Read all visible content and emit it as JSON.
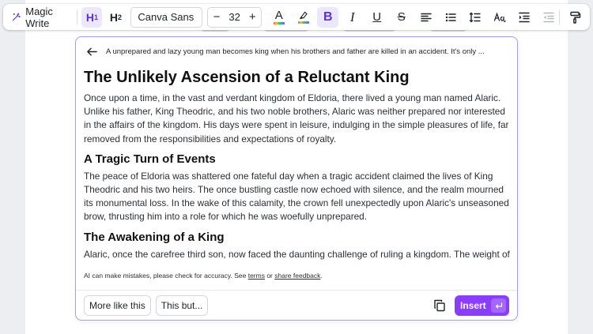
{
  "toolbar": {
    "magic_write_label": "Magic Write",
    "h1_label": "H",
    "h1_sub": "1",
    "h2_label": "H",
    "h2_sub": "2",
    "font_family": "Canva Sans",
    "font_size": "32",
    "decrement": "−",
    "increment": "+",
    "text_color_glyph": "A",
    "bold_glyph": "B",
    "italic_glyph": "I",
    "underline_glyph": "U",
    "strike_glyph": "S",
    "accent_color": "#5a32d6",
    "icons": [
      "magic-write-icon",
      "text-color-icon",
      "highlight-icon",
      "bold-icon",
      "italic-icon",
      "underline-icon",
      "strikethrough-icon",
      "align-left-icon",
      "bullet-list-icon",
      "line-spacing-icon",
      "text-case-icon",
      "indent-icon",
      "outdent-icon",
      "paint-roller-icon"
    ]
  },
  "card": {
    "prompt": "A unprepared and lazy young man becomes king when his brothers and father are killed in an accident. It's only ...",
    "title": "The Unlikely Ascension of a Reluctant King",
    "sections": [
      {
        "paragraph": "Once upon a time, in the vast and verdant kingdom of Eldoria, there lived a young man named Alaric. Unlike his father, King Theodric, and his two noble brothers, Alaric was neither prepared nor interested in the affairs of the kingdom. His days were spent in leisure, indulging in the simple pleasures of life, far removed from the responsibilities and expectations of royalty."
      },
      {
        "heading": "A Tragic Turn of Events",
        "paragraph": "The peace of Eldoria was shattered one fateful day when a tragic accident claimed the lives of King Theodric and his two heirs. The once bustling castle now echoed with silence, and the realm mourned its monumental loss. In the wake of this calamity, the crown fell unexpectedly upon Alaric's unseasoned brow, thrusting him into a role for which he was woefully unprepared."
      },
      {
        "heading": "The Awakening of a King",
        "paragraph": "Alaric, once the carefree third son, now faced the daunting challenge of ruling a kingdom. The weight of"
      }
    ],
    "disclaimer_prefix": "AI can make mistakes, please check for accuracy. See ",
    "disclaimer_terms": "terms",
    "disclaimer_or": " or ",
    "disclaimer_feedback": "share feedback",
    "disclaimer_suffix": ".",
    "more_like_this": "More like this",
    "this_but": "This but...",
    "insert_label": "Insert",
    "insert_color": "#8b3dff",
    "border_color": "#a89be8"
  }
}
